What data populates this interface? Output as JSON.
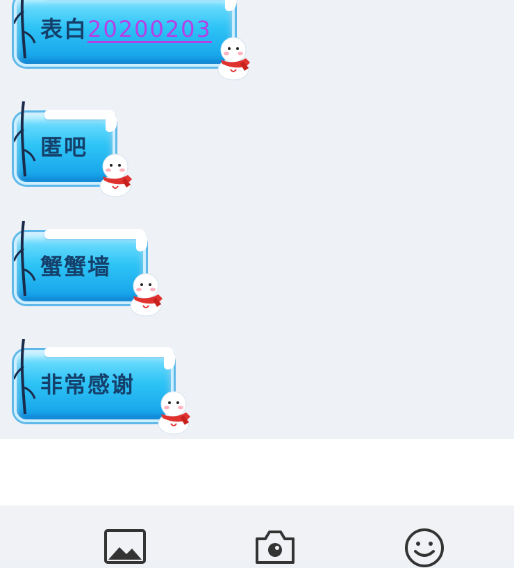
{
  "chat": {
    "messages": [
      {
        "prefix": "表白",
        "link": "20200203"
      },
      {
        "text": "匿吧"
      },
      {
        "text": "蟹蟹墙"
      },
      {
        "text": "非常感谢"
      }
    ]
  },
  "toolbar": {
    "icons": [
      "image-icon",
      "camera-icon",
      "emoji-icon"
    ]
  },
  "colors": {
    "bubble": "#2ec4f6",
    "link": "#b83ee6",
    "text": "#15406b",
    "background": "#eef1f6"
  }
}
